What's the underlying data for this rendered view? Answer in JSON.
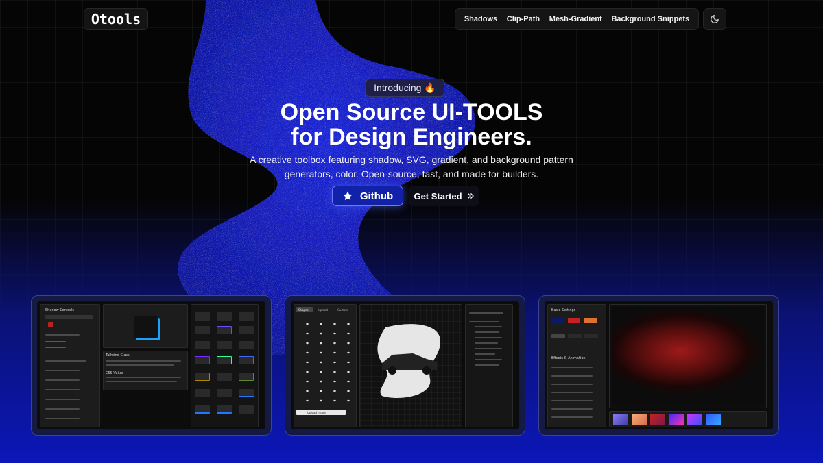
{
  "header": {
    "logo_text": "Otools",
    "nav": [
      "Shadows",
      "Clip-Path",
      "Mesh-Gradient",
      "Background Snippets"
    ],
    "theme_icon": "moon-icon"
  },
  "hero": {
    "badge_text": "Introducing",
    "badge_emoji": "🔥",
    "title_line1": "Open Source UI-TOOLS",
    "title_line2": "for Design Engineers.",
    "description_line1": "A creative toolbox featuring shadow, SVG, gradient, and background pattern",
    "description_line2": "generators, color. Open-source, fast, and made for builders.",
    "github_label": "Github",
    "get_started_label": "Get Started",
    "github_icon": "star-icon",
    "get_started_icon": "double-chevron-right-icon"
  },
  "previews": {
    "shadow": {
      "controls_title": "Shadow Controls",
      "tailwind_title": "Tailwind Class",
      "css_title": "CSS Value"
    },
    "clip": {
      "tabs": [
        "Shapes",
        "Upload",
        "Custom"
      ],
      "upload_label": "Upload Image"
    },
    "mesh": {
      "settings_title": "Basic Settings",
      "effects_title": "Effects & Animation"
    }
  },
  "colors": {
    "accent": "#1222a8",
    "accent_border": "#6b7bff",
    "blob": "#1722c8",
    "background": "#050505"
  }
}
